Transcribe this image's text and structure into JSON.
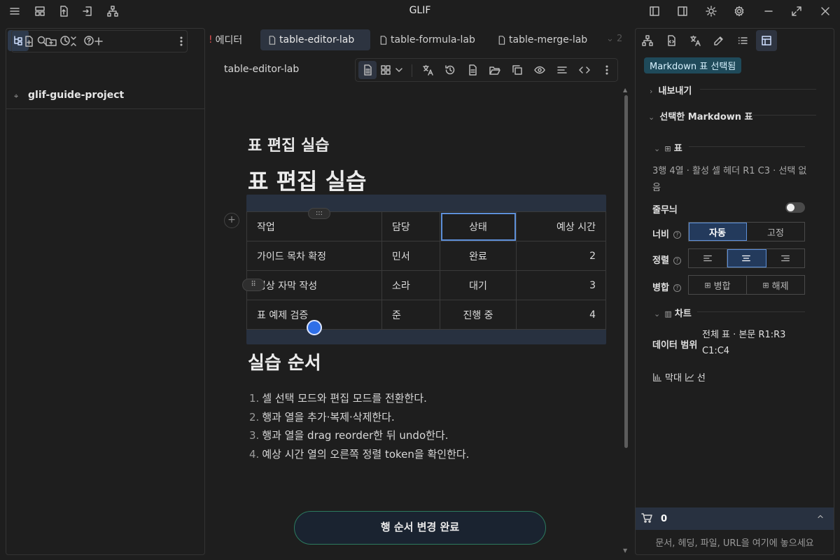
{
  "app": {
    "title": "GLIF"
  },
  "icons": {
    "titlebar_left": [
      "menu-icon",
      "layout-icon",
      "upload-icon",
      "import-icon",
      "sitemap-icon"
    ],
    "titlebar_right": [
      "sidebar-left-icon",
      "sidebar-right-icon",
      "theme-sun-icon",
      "settings-gear-icon",
      "minimize-icon",
      "maximize-icon",
      "close-icon"
    ]
  },
  "left_panel": {
    "tabs": [
      "file-tree-icon",
      "search-icon",
      "history-icon",
      "help-icon"
    ],
    "toolbar": [
      "new-file-icon",
      "new-folder-icon",
      "collapse-icon",
      "add-icon",
      "more-icon"
    ],
    "vault_name": "glif-guide-project"
  },
  "tabs": [
    {
      "label": "에디터"
    },
    {
      "label": "table-editor-lab",
      "active": true
    },
    {
      "label": "table-formula-lab"
    },
    {
      "label": "table-merge-lab"
    }
  ],
  "tab_overflow": "2",
  "editor": {
    "note_title": "table-editor-lab",
    "toolbar_icons": [
      "document-mode-icon",
      "grid-icon",
      "chevron-down-icon",
      "translate-icon",
      "history-icon",
      "file-icon",
      "folder-open-icon",
      "copy-icon",
      "eye-icon",
      "align-icon",
      "code-icon",
      "more-icon"
    ]
  },
  "content": {
    "heading_small": "표 편집 실습",
    "heading_big": "표 편집 실습",
    "table": {
      "headers": [
        "작업",
        "담당",
        "상태",
        "예상 시간"
      ],
      "rows": [
        [
          "가이드 목차 확정",
          "민서",
          "완료",
          "2"
        ],
        [
          "영상 자막 작성",
          "소라",
          "대기",
          "3"
        ],
        [
          "표 예제 검증",
          "준",
          "진행 중",
          "4"
        ]
      ],
      "add_column": "+",
      "drag_handle": ":::"
    },
    "section_heading": "실습 순서",
    "steps": [
      "셀 선택 모드와 편집 모드를 전환한다.",
      "행과 열을 추가·복제·삭제한다.",
      "행과 열을 drag reorder한 뒤 undo한다.",
      "예상 시간 열의 오른쪽 정렬 token을 확인한다."
    ]
  },
  "toast": "행 순서 변경 완료",
  "right_panel": {
    "tabs": [
      "sitemap-icon",
      "file-code-icon",
      "translate-icon",
      "edit-icon",
      "list-icon",
      "table-icon"
    ],
    "badge": "Markdown 표 선택됨",
    "export_label": "내보내기",
    "selected_table_label": "선택한 Markdown 표",
    "table_section": "표",
    "table_info": "3행 4열 · 활성 셀 헤더 R1 C3 · 선택 없음",
    "stripes_label": "줄무늬",
    "stripes_on": false,
    "width_label": "너비",
    "width_options": [
      "자동",
      "고정"
    ],
    "align_label": "정렬",
    "merge_label": "병합",
    "merge_options": [
      "병합",
      "해제"
    ],
    "chart_section": "차트",
    "data_range_label": "데이터 범위",
    "data_range_value": "전체 표 · 본문 R1:R3 C1:C4",
    "chart_types": [
      "막대",
      "선"
    ]
  },
  "basket": {
    "count": "0",
    "drop_hint": "문서, 헤딩, 파일, URL을 여기에 놓으세요"
  },
  "colors": {
    "accent": "#5d8fd8",
    "badge_bg": "#1f4a5a",
    "toast_border": "#2c7a5f",
    "cursor_dot": "#2f6fe8"
  }
}
